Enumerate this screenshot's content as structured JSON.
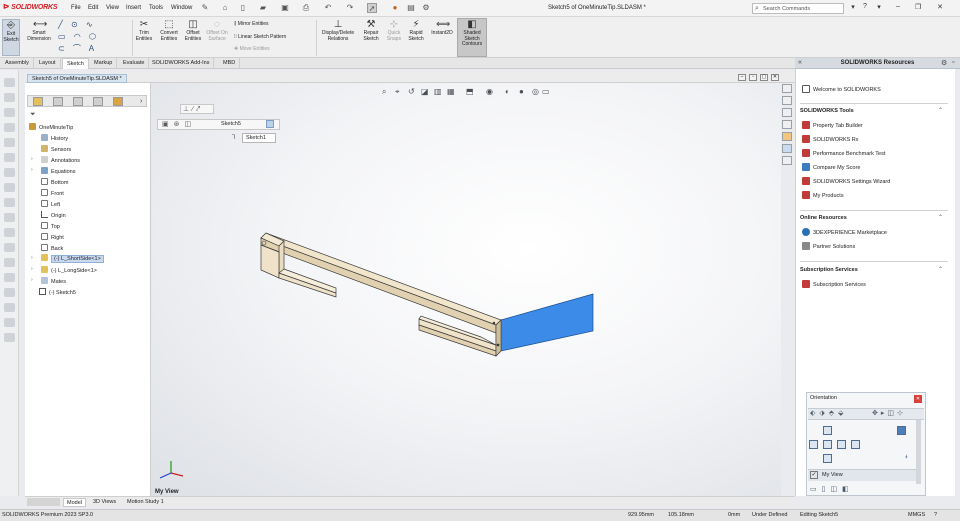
{
  "titlebar": {
    "app_name": "SOLIDWORKS",
    "menus": [
      "File",
      "Edit",
      "View",
      "Insert",
      "Tools",
      "Window"
    ],
    "document_title": "Sketch5 of OneMinuteTip.SLDASM *",
    "search_placeholder": "Search Commands"
  },
  "ribbon": {
    "exit_sketch": "Exit Sketch",
    "smart_dimension": "Smart Dimension",
    "trim_entities": "Trim Entities",
    "convert_entities": "Convert Entities",
    "offset_entities": "Offset Entities",
    "offset_on_surface": "Offset On Surface",
    "mirror_entities": "Mirror Entities",
    "linear_sketch_pattern": "Linear Sketch Pattern",
    "move_entities": "Move Entities",
    "display_delete_relations": "Display/Delete Relations",
    "repair_sketch": "Repair Sketch",
    "quick_snaps": "Quick Snaps",
    "rapid_sketch": "Rapid Sketch",
    "instant2d": "Instant2D",
    "shaded_sketch_contours": "Shaded Sketch Contours"
  },
  "tabs": [
    "Assembly",
    "Layout",
    "Sketch",
    "Markup",
    "Evaluate",
    "SOLIDWORKS Add-Ins",
    "MBD"
  ],
  "active_tab": "Sketch",
  "doc_tab": "Sketch5 of OneMinuteTip.SLDASM *",
  "tree": {
    "root": "OneMinuteTip",
    "items": [
      "History",
      "Sensors",
      "Annotations",
      "Equations",
      "Bottom",
      "Front",
      "Left",
      "Origin",
      "Top",
      "Right",
      "Back"
    ],
    "components": [
      "(-) L_ShortSide<1>",
      "(-) L_LongSide<1>"
    ],
    "mates": "Mates",
    "sketch": "(-) Sketch5"
  },
  "sketch_popup": {
    "label": "Sketch5",
    "name_field": "Sketch1"
  },
  "taskpane": {
    "title": "SOLIDWORKS Resources",
    "welcome": "Welcome to SOLIDWORKS",
    "tools_title": "SOLIDWORKS Tools",
    "tools": [
      "Property Tab Builder",
      "SOLIDWORKS Rx",
      "Performance Benchmark Test",
      "Compare My Score",
      "SOLIDWORKS Settings Wizard",
      "My Products"
    ],
    "online_title": "Online Resources",
    "online": [
      "3DEXPERIENCE Marketplace",
      "Partner Solutions"
    ],
    "subs_title": "Subscription Services",
    "subs": [
      "Subscription Services"
    ]
  },
  "orientation": {
    "title": "Orientation",
    "my_view": "My View"
  },
  "triad_label": "My View",
  "bottom_tabs": [
    "Model",
    "3D Views",
    "Motion Study 1"
  ],
  "active_bottom_tab": "Model",
  "status": {
    "product": "SOLIDWORKS Premium 2023 SP3.0",
    "x": "929.95mm",
    "y": "105.18mm",
    "z": "0mm",
    "state": "Under Defined",
    "editing": "Editing Sketch5",
    "units": "MMGS"
  },
  "colors": {
    "selected_face": "#3d8be8",
    "part_color": "#f4e9d1",
    "accent_red": "#d21f26"
  }
}
